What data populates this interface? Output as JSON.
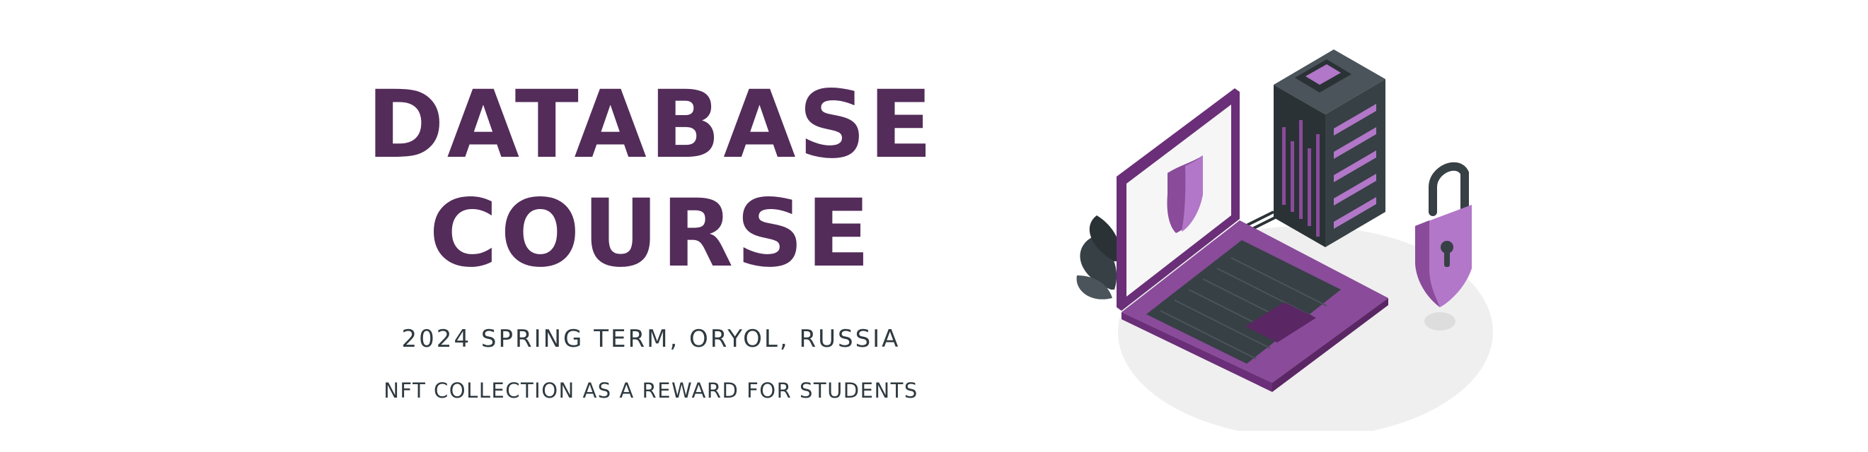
{
  "banner": {
    "title_line1": "DATABASE",
    "title_line2": "COURSE",
    "subtitle": "2024 SPRING TERM, ORYOL, RUSSIA",
    "tagline": "NFT COLLECTION AS A REWARD FOR STUDENTS"
  },
  "illustration": {
    "icons": [
      "laptop-icon",
      "shield-icon",
      "server-rack-icon",
      "padlock-icon",
      "plant-icon"
    ]
  },
  "colors": {
    "title": "#532c5a",
    "text": "#2f3a40",
    "accent_purple": "#8a4b9a",
    "light_purple": "#b277c8",
    "dark_slate": "#374045",
    "floor": "#efefef"
  }
}
